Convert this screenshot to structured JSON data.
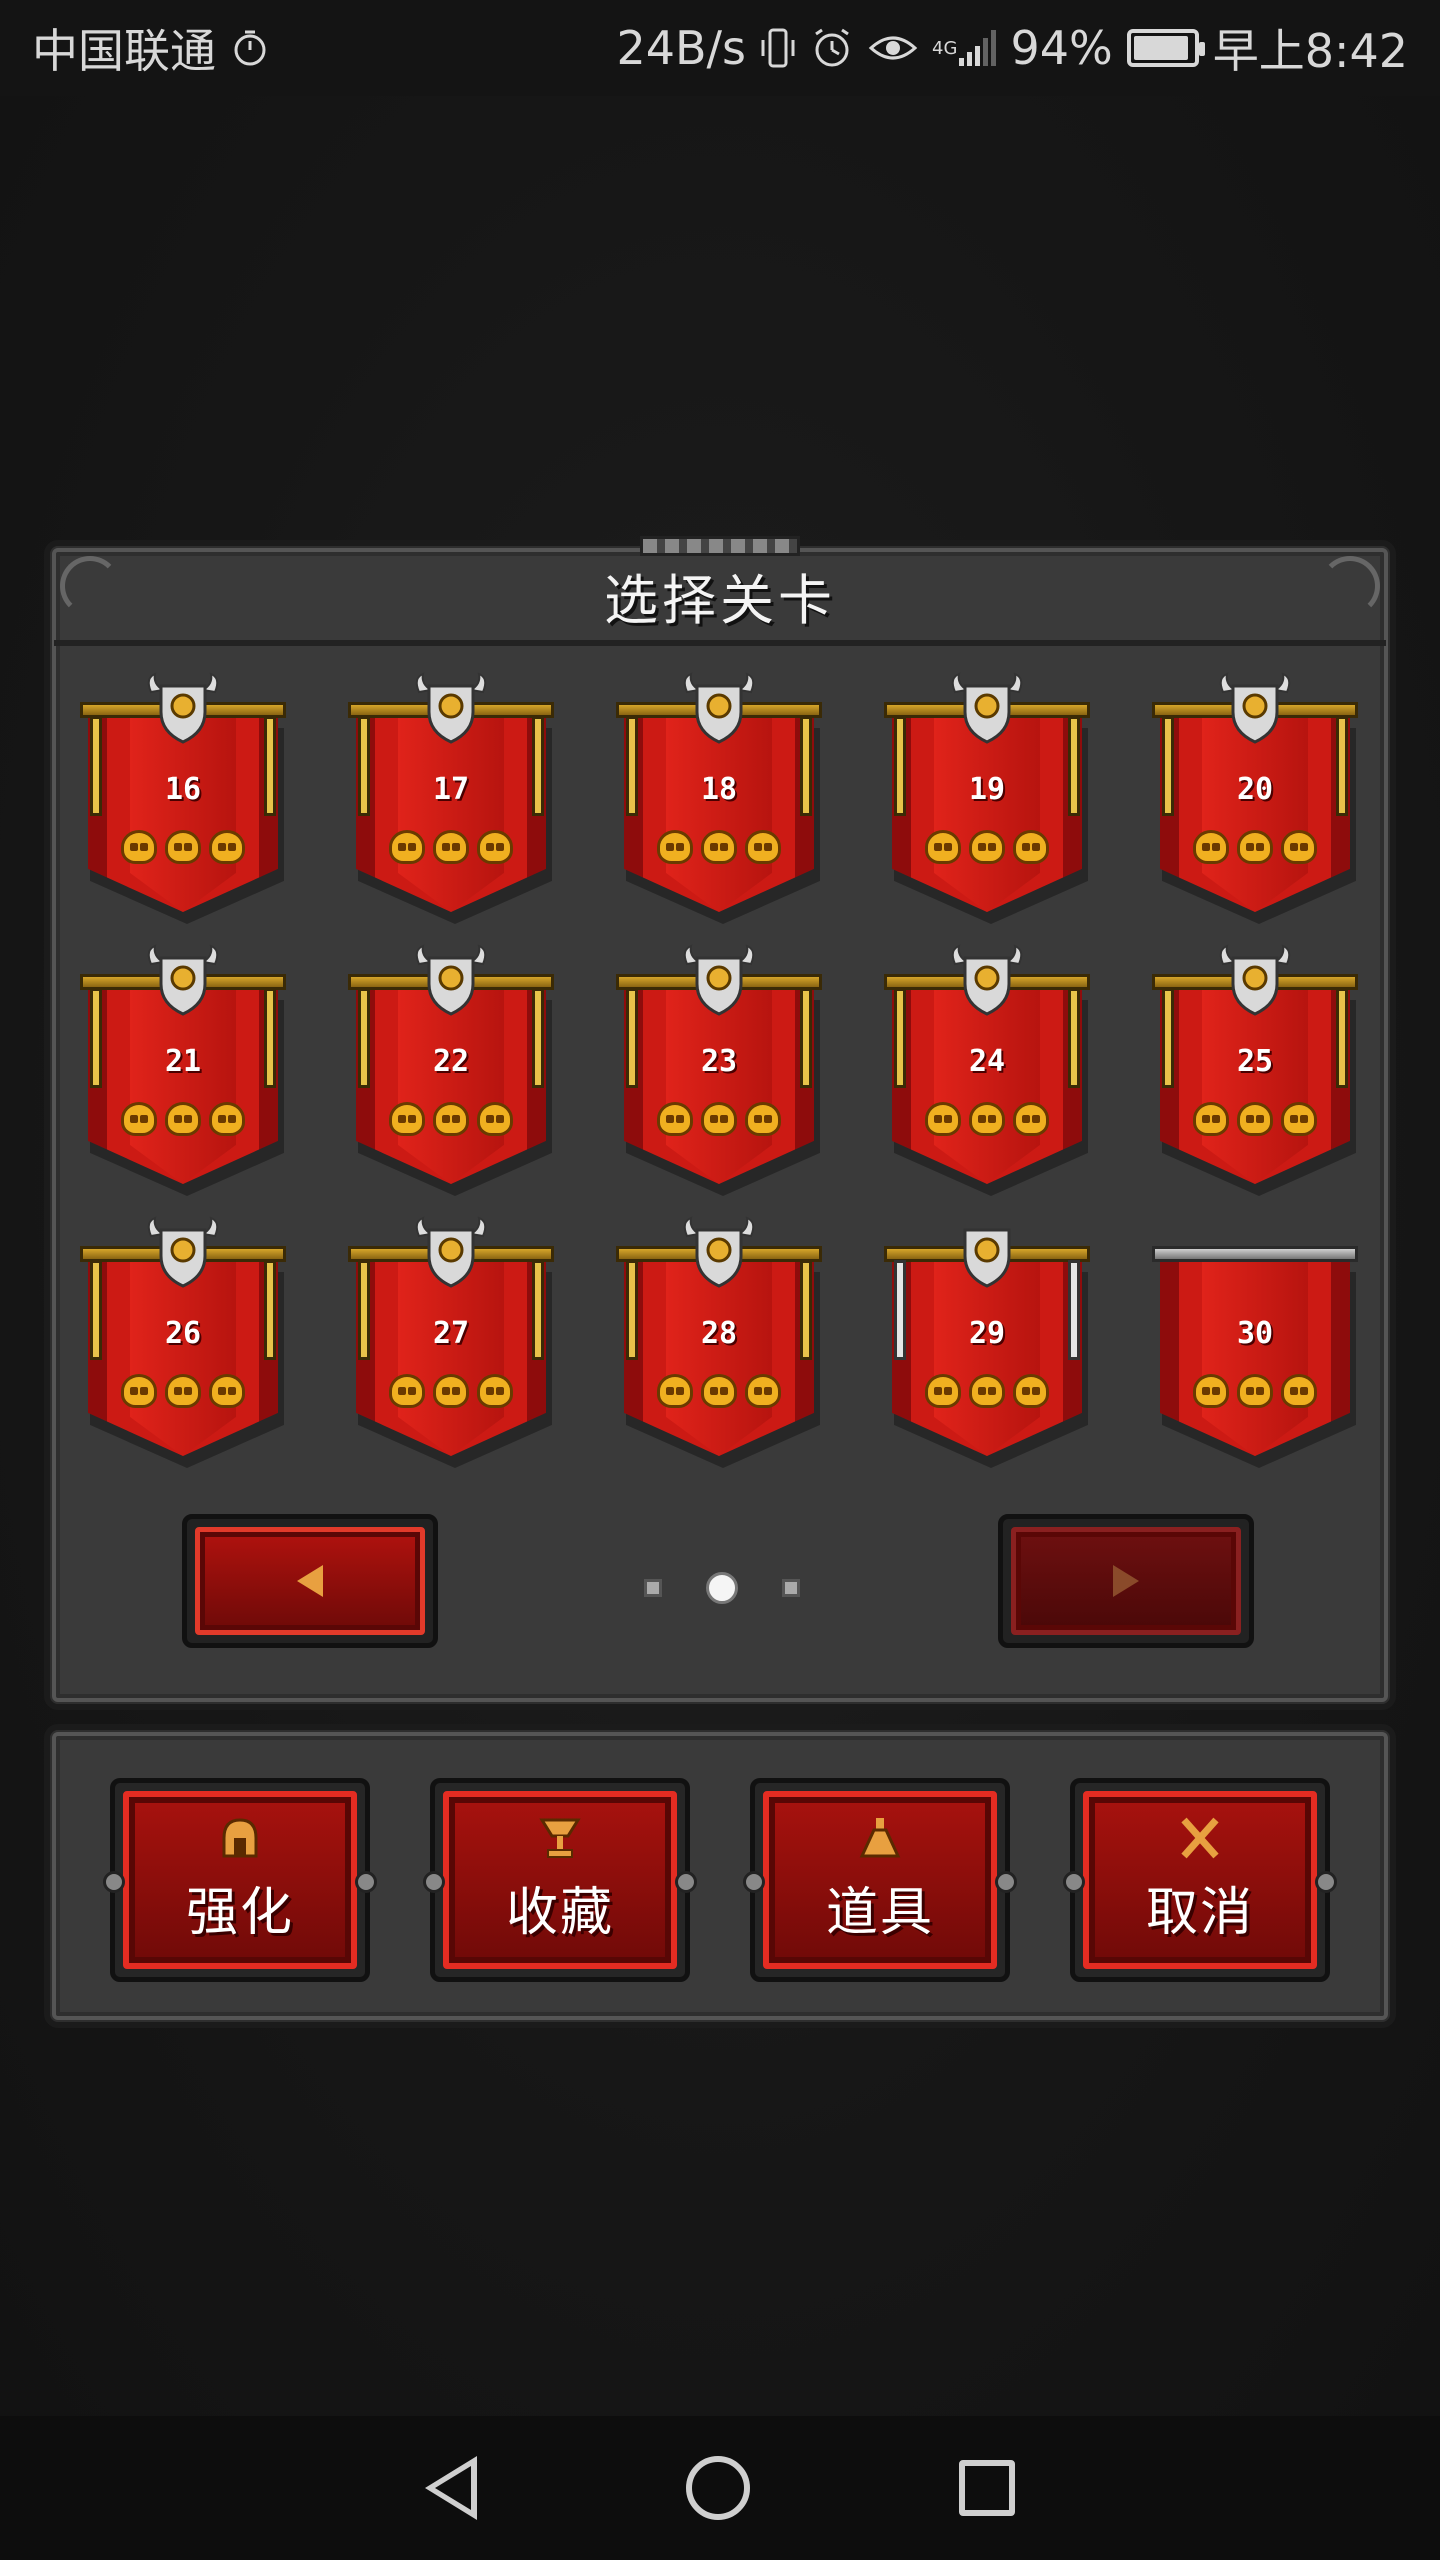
{
  "status_bar": {
    "carrier": "中国联通",
    "net_speed": "24B/s",
    "network_type": "4G",
    "battery": "94%",
    "battery_level": 0.94,
    "time": "早上8:42",
    "icons": [
      "timer-icon",
      "vibrate-icon",
      "alarm-icon",
      "eye-icon",
      "signal-icon",
      "battery-icon"
    ]
  },
  "dialog": {
    "title": "选择关卡",
    "stages": [
      {
        "number": "16",
        "skulls": 3,
        "style": "gold-shield"
      },
      {
        "number": "17",
        "skulls": 3,
        "style": "gold-shield"
      },
      {
        "number": "18",
        "skulls": 3,
        "style": "gold-shield"
      },
      {
        "number": "19",
        "skulls": 3,
        "style": "gold-shield"
      },
      {
        "number": "20",
        "skulls": 3,
        "style": "gold-shield"
      },
      {
        "number": "21",
        "skulls": 3,
        "style": "gold-shield"
      },
      {
        "number": "22",
        "skulls": 3,
        "style": "gold-shield"
      },
      {
        "number": "23",
        "skulls": 3,
        "style": "gold-shield"
      },
      {
        "number": "24",
        "skulls": 3,
        "style": "gold-shield"
      },
      {
        "number": "25",
        "skulls": 3,
        "style": "gold-shield"
      },
      {
        "number": "26",
        "skulls": 3,
        "style": "gold-shield"
      },
      {
        "number": "27",
        "skulls": 3,
        "style": "gold-shield"
      },
      {
        "number": "28",
        "skulls": 3,
        "style": "gold-shield"
      },
      {
        "number": "29",
        "skulls": 3,
        "style": "silver-shield"
      },
      {
        "number": "30",
        "skulls": 3,
        "style": "no-shield"
      }
    ],
    "pager": {
      "pages": 3,
      "current": 2
    },
    "prev_enabled": true,
    "next_enabled": false
  },
  "actions": [
    {
      "label": "强化",
      "icon": "helmet-icon"
    },
    {
      "label": "收藏",
      "icon": "trophy-icon"
    },
    {
      "label": "道具",
      "icon": "potion-icon"
    },
    {
      "label": "取消",
      "icon": "cross-icon"
    }
  ],
  "colors": {
    "banner_red": "#cc1a14",
    "gold": "#e8c34a",
    "panel": "#3a3a3a",
    "button_border": "#e42c22"
  }
}
